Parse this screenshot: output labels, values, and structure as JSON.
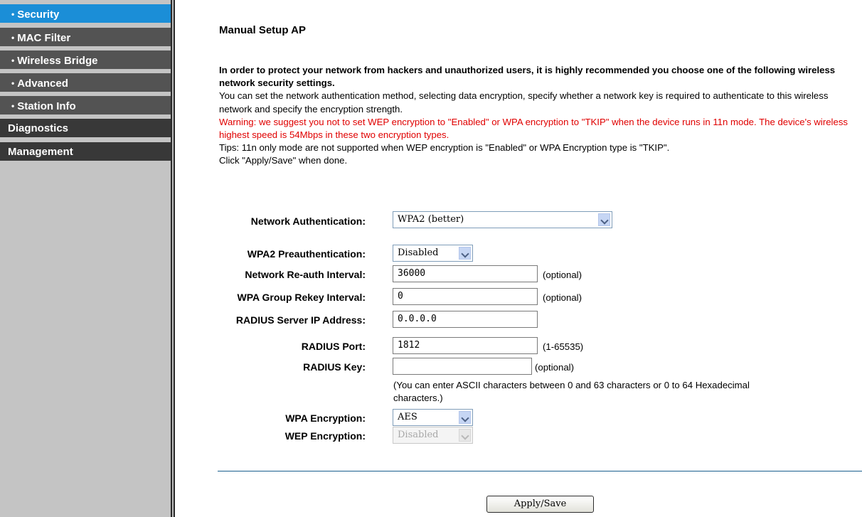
{
  "sidebar": {
    "items": [
      {
        "label": "Security",
        "bullet": "•"
      },
      {
        "label": "MAC Filter",
        "bullet": "•"
      },
      {
        "label": "Wireless Bridge",
        "bullet": "•"
      },
      {
        "label": "Advanced",
        "bullet": "•"
      },
      {
        "label": "Station Info",
        "bullet": "•"
      },
      {
        "label": "Diagnostics"
      },
      {
        "label": "Management"
      }
    ],
    "active_color": "#1b8ed7"
  },
  "main": {
    "title": "Manual Setup AP",
    "intro_bold": "In order to protect your network from hackers and unauthorized users, it is highly recommended you choose one of the following wireless network security settings.",
    "intro_text": "You can set the network authentication method, selecting data encryption, specify whether a network key is required to authenticate to this wireless network and specify the encryption strength.",
    "warning": "Warning: we suggest you not to set WEP encryption to \"Enabled\" or WPA encryption to \"TKIP\" when the device runs in 11n mode. The device's wireless highest speed is 54Mbps in these two encryption types.",
    "tips": "Tips: 11n only mode are not supported when WEP encryption is \"Enabled\" or WPA Encryption type is \"TKIP\".",
    "click_note": "Click \"Apply/Save\" when done.",
    "warning_color": "#e00000"
  },
  "form": {
    "network_auth": {
      "label": "Network Authentication:",
      "value": "WPA2 (better)"
    },
    "wpa2_preauth": {
      "label": "WPA2 Preauthentication:",
      "value": "Disabled"
    },
    "reauth_interval": {
      "label": "Network Re-auth Interval:",
      "value": "36000",
      "hint": "(optional)"
    },
    "group_rekey": {
      "label": "WPA Group Rekey Interval:",
      "value": "0",
      "hint": "(optional)"
    },
    "radius_ip": {
      "label": "RADIUS Server IP Address:",
      "value": "0.0.0.0"
    },
    "radius_port": {
      "label": "RADIUS Port:",
      "value": "1812",
      "hint": "(1-65535)"
    },
    "radius_key": {
      "label": "RADIUS Key:",
      "value": "",
      "hint": "(optional)",
      "note": "(You can enter ASCII characters between 0 and 63 characters or 0 to 64 Hexadecimal characters.)"
    },
    "wpa_encryption": {
      "label": "WPA Encryption:",
      "value": "AES"
    },
    "wep_encryption": {
      "label": "WEP Encryption:",
      "value": "Disabled"
    }
  },
  "actions": {
    "apply_label": "Apply/Save"
  }
}
